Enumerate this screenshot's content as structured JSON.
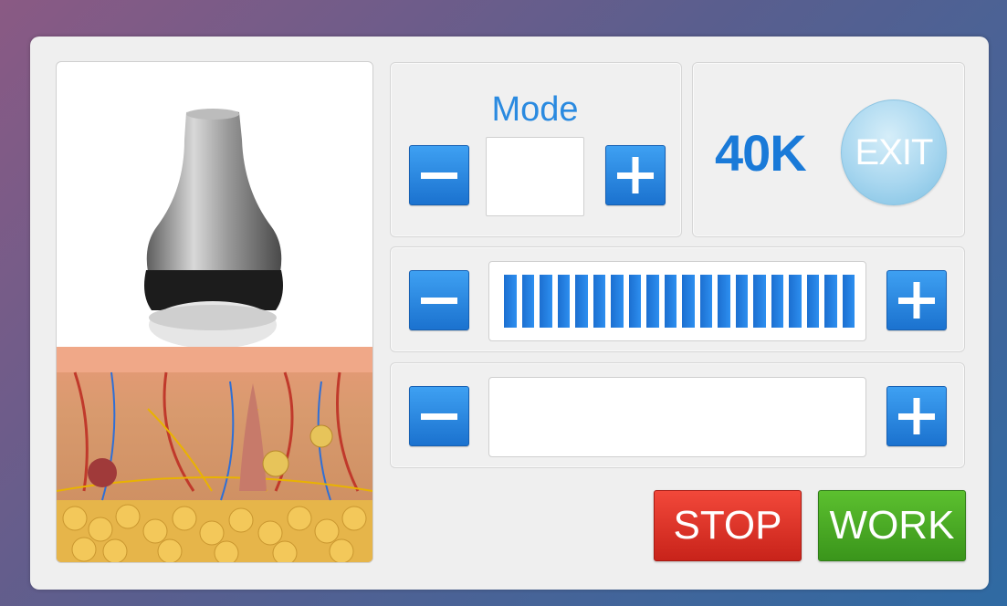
{
  "mode": {
    "label": "Mode",
    "value": ""
  },
  "frequency": {
    "label": "40K"
  },
  "exit": {
    "label": "EXIT"
  },
  "level1": {
    "segments_filled": 20,
    "segments_total": 20
  },
  "level2": {
    "segments_filled": 0,
    "segments_total": 20
  },
  "actions": {
    "stop_label": "STOP",
    "work_label": "WORK"
  },
  "colors": {
    "accent": "#2a8ae0",
    "stop": "#e0302a",
    "work": "#4aab24",
    "exit": "#a7d6ef"
  },
  "icons": {
    "minus": "minus-icon",
    "plus": "plus-icon"
  }
}
